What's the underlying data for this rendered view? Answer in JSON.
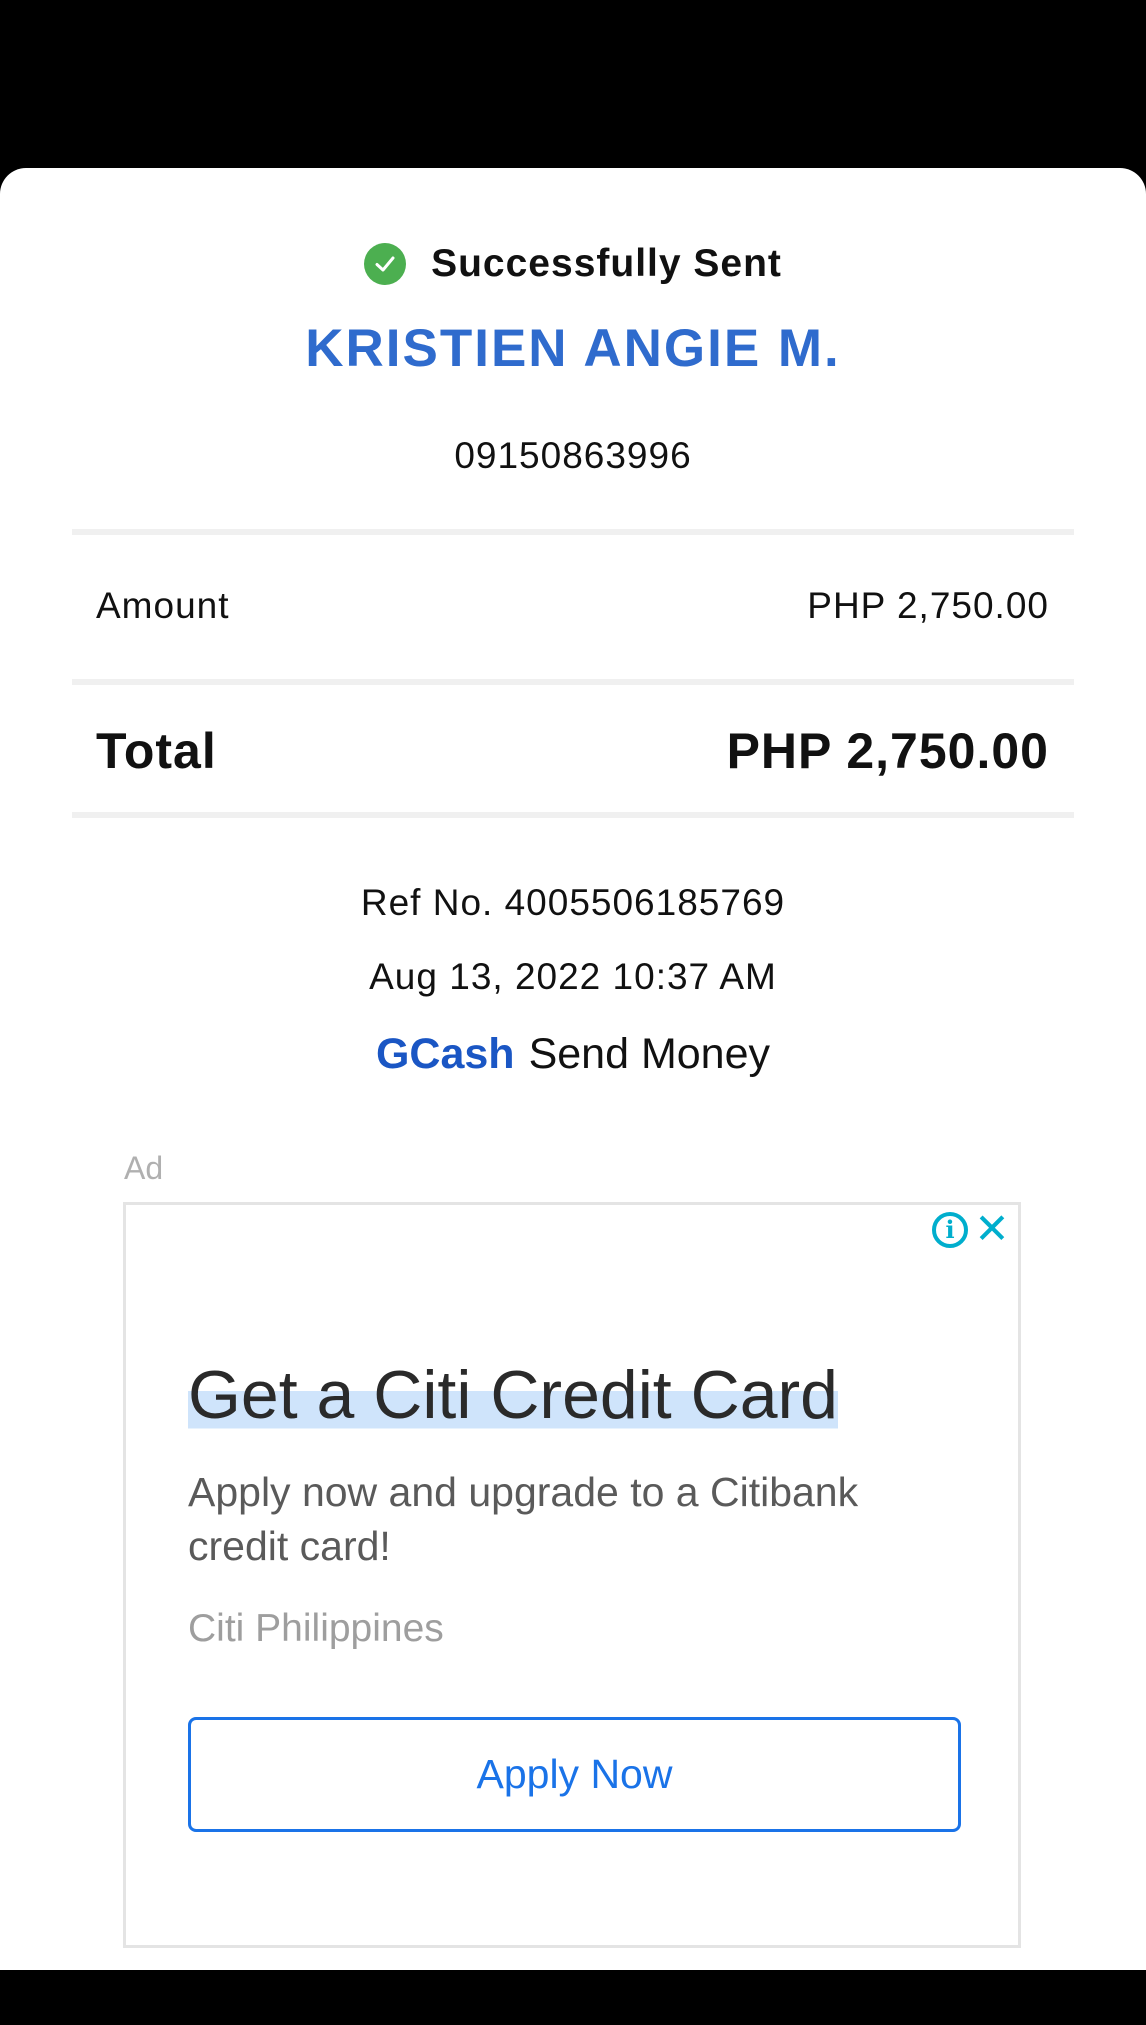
{
  "status": {
    "icon": "check-circle-icon",
    "text": "Successfully Sent",
    "color": "#4caf50"
  },
  "recipient": {
    "name": "KRISTIEN ANGIE M.",
    "phone": "09150863996",
    "color": "#2f6bcd"
  },
  "breakdown": {
    "amount_label": "Amount",
    "amount_value": "PHP 2,750.00",
    "total_label": "Total",
    "total_value": "PHP 2,750.00"
  },
  "transaction": {
    "ref": "Ref No. 4005506185769",
    "datetime": "Aug 13, 2022 10:37 AM",
    "brand": "GCash",
    "service": "Send Money",
    "brand_color": "#1a56c4"
  },
  "ad": {
    "tag": "Ad",
    "info_icon": "info-icon",
    "close_icon": "close-icon",
    "headline": "Get a Citi Credit Card",
    "body": "Apply now and upgrade to a Citibank credit card!",
    "advertiser": "Citi Philippines",
    "cta": "Apply Now",
    "accent": "#1a73e8"
  }
}
